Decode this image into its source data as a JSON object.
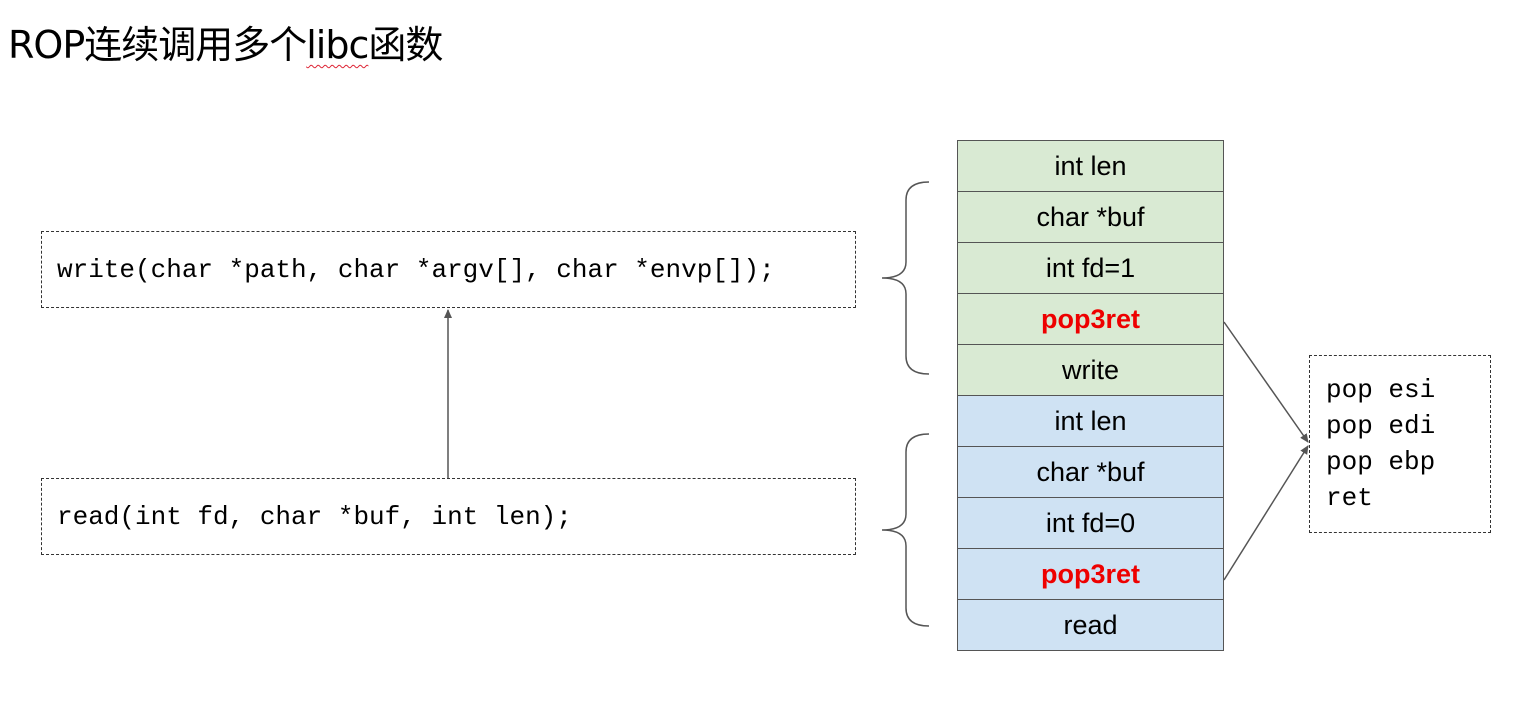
{
  "title": {
    "prefix": "ROP连续调用多个",
    "libc": "libc",
    "suffix": "函数"
  },
  "functions": {
    "write_sig": "write(char *path, char *argv[], char *envp[]);",
    "read_sig": "read(int fd, char *buf, int len);"
  },
  "stack": [
    {
      "label": "int len",
      "group": "write",
      "highlight": false
    },
    {
      "label": "char *buf",
      "group": "write",
      "highlight": false
    },
    {
      "label": "int fd=1",
      "group": "write",
      "highlight": false
    },
    {
      "label": "pop3ret",
      "group": "write",
      "highlight": true
    },
    {
      "label": "write",
      "group": "write",
      "highlight": false
    },
    {
      "label": "int len",
      "group": "read",
      "highlight": false
    },
    {
      "label": "char *buf",
      "group": "read",
      "highlight": false
    },
    {
      "label": "int fd=0",
      "group": "read",
      "highlight": false
    },
    {
      "label": "pop3ret",
      "group": "read",
      "highlight": true
    },
    {
      "label": "read",
      "group": "read",
      "highlight": false
    }
  ],
  "gadget": [
    "pop esi",
    "pop edi",
    "pop ebp",
    "ret"
  ],
  "colors": {
    "write_frame": "#d9ead3",
    "read_frame": "#cfe2f3",
    "highlight_text": "#ee0000",
    "arrow": "#555555"
  }
}
